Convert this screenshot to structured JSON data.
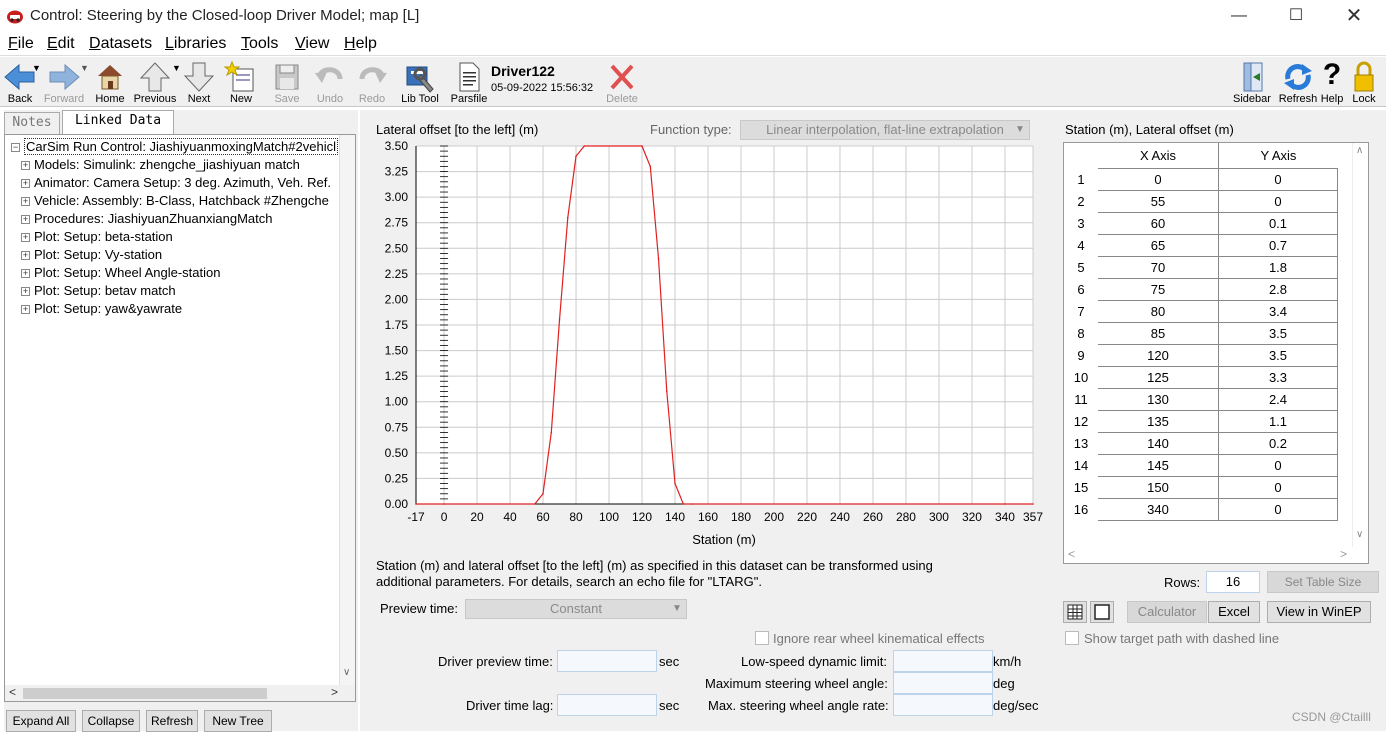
{
  "window": {
    "title": "Control: Steering by the Closed-loop Driver Model;   map [L]"
  },
  "menu": [
    {
      "key": "F",
      "rest": "ile"
    },
    {
      "key": "E",
      "rest": "dit"
    },
    {
      "key": "D",
      "rest": "atasets"
    },
    {
      "key": "L",
      "rest": "ibraries"
    },
    {
      "key": "T",
      "rest": "ools"
    },
    {
      "key": "V",
      "rest": "iew"
    },
    {
      "key": "H",
      "rest": "elp"
    }
  ],
  "toolbar": {
    "back": "Back",
    "forward": "Forward",
    "home": "Home",
    "previous": "Previous",
    "next": "Next",
    "new": "New",
    "save": "Save",
    "undo": "Undo",
    "redo": "Redo",
    "libtool": "Lib Tool",
    "parsfile": "Parsfile",
    "delete": "Delete",
    "dataset_name": "Driver122",
    "dataset_date": "05-09-2022 15:56:32",
    "sidebar": "Sidebar",
    "refresh": "Refresh",
    "help": "Help",
    "lock": "Lock"
  },
  "left": {
    "tab_notes": "Notes",
    "tab_linked": "Linked Data",
    "tree_root": "CarSim Run Control: JiashiyuanmoxingMatch#2vehicl",
    "tree_items": [
      "Models: Simulink: zhengche_jiashiyuan match",
      "Animator: Camera Setup: 3 deg. Azimuth, Veh. Ref.",
      "Vehicle: Assembly: B-Class, Hatchback #Zhengche",
      "Procedures: JiashiyuanZhuanxiangMatch",
      "Plot: Setup: beta-station",
      "Plot: Setup: Vy-station",
      "Plot: Setup: Wheel Angle-station",
      "Plot: Setup: betav match",
      "Plot: Setup: yaw&yawrate"
    ],
    "btn_expand": "Expand All",
    "btn_collapse": "Collapse",
    "btn_refresh": "Refresh",
    "btn_newtree": "New Tree"
  },
  "main": {
    "chart_ylabel": "Lateral offset [to the left] (m)",
    "function_type_label": "Function type:",
    "function_type_value": "Linear interpolation, flat-line extrapolation",
    "note_line1": "Station (m) and lateral offset [to the left] (m) as specified in this dataset can be transformed using",
    "note_line2": "additional parameters. For details, search an echo file for \"LTARG\".",
    "preview_time_label": "Preview time:",
    "preview_time_value": "Constant",
    "ignore_rear": "Ignore rear wheel kinematical effects",
    "driver_preview_label": "Driver preview time:",
    "driver_preview_unit": "sec",
    "driver_lag_label": "Driver time lag:",
    "driver_lag_unit": "sec",
    "low_speed_label": "Low-speed dynamic limit:",
    "low_speed_unit": "km/h",
    "max_angle_label": "Maximum steering wheel angle:",
    "max_angle_unit": "deg",
    "max_rate_label": "Max. steering wheel angle rate:",
    "max_rate_unit": "deg/sec"
  },
  "table": {
    "title": "Station (m), Lateral offset (m)",
    "col_x": "X Axis",
    "col_y": "Y Axis",
    "rows": [
      [
        "1",
        "0",
        "0"
      ],
      [
        "2",
        "55",
        "0"
      ],
      [
        "3",
        "60",
        "0.1"
      ],
      [
        "4",
        "65",
        "0.7"
      ],
      [
        "5",
        "70",
        "1.8"
      ],
      [
        "6",
        "75",
        "2.8"
      ],
      [
        "7",
        "80",
        "3.4"
      ],
      [
        "8",
        "85",
        "3.5"
      ],
      [
        "9",
        "120",
        "3.5"
      ],
      [
        "10",
        "125",
        "3.3"
      ],
      [
        "11",
        "130",
        "2.4"
      ],
      [
        "12",
        "135",
        "1.1"
      ],
      [
        "13",
        "140",
        "0.2"
      ],
      [
        "14",
        "145",
        "0"
      ],
      [
        "15",
        "150",
        "0"
      ],
      [
        "16",
        "340",
        "0"
      ]
    ],
    "rows_label": "Rows:",
    "rows_value": "16",
    "set_size": "Set Table Size",
    "calculator": "Calculator",
    "excel": "Excel",
    "view_winep": "View in WinEP",
    "show_dashed": "Show target path with dashed line"
  },
  "watermark": "CSDN @Ctailll",
  "chart_data": {
    "type": "line",
    "ylabel": "Lateral offset [to the left] (m)",
    "xlabel": "Station (m)",
    "xlim": [
      -17,
      357
    ],
    "ylim": [
      0,
      3.5
    ],
    "xticks": [
      -17,
      0,
      20,
      40,
      60,
      80,
      100,
      120,
      140,
      160,
      180,
      200,
      220,
      240,
      260,
      280,
      300,
      320,
      340,
      357
    ],
    "yticks": [
      "0.00",
      "0.25",
      "0.50",
      "0.75",
      "1.00",
      "1.25",
      "1.50",
      "1.75",
      "2.00",
      "2.25",
      "2.50",
      "2.75",
      "3.00",
      "3.25",
      "3.50"
    ],
    "grid": true,
    "series_color": "#e02020",
    "x": [
      -17,
      0,
      55,
      60,
      65,
      70,
      75,
      80,
      85,
      120,
      125,
      130,
      135,
      140,
      145,
      150,
      340,
      357
    ],
    "y": [
      0,
      0,
      0,
      0.1,
      0.7,
      1.8,
      2.8,
      3.4,
      3.5,
      3.5,
      3.3,
      2.4,
      1.1,
      0.2,
      0,
      0,
      0,
      0
    ]
  }
}
